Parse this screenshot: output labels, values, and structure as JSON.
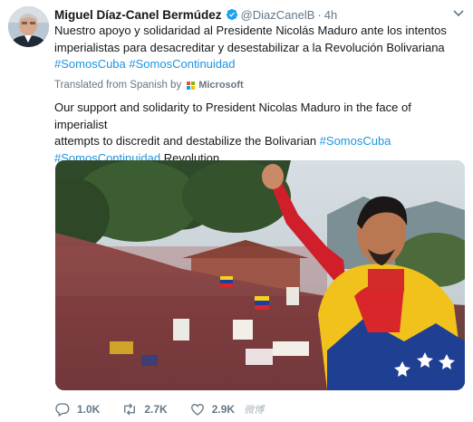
{
  "author": {
    "name": "Miguel Díaz-Canel Bermúdez",
    "handle": "@DiazCanelB",
    "separator": "·",
    "time": "4h",
    "verified": true
  },
  "tweet": {
    "original_line1": "Nuestro apoyo y solidaridad al Presidente Nicolás Maduro ante los intentos",
    "original_line2": "imperialistas para desacreditar y desestabilizar a la Revolución Bolivariana",
    "original_tag1": "#SomosCuba",
    "original_tag2": "#SomosContinuidad",
    "translated_by": "Translated from Spanish by",
    "translator": "Microsoft",
    "translated_line1": "Our support and solidarity to President Nicolas Maduro in the face of imperialist",
    "translated_line2a": "attempts to discredit and destabilize the Bolivarian",
    "translated_tag1": "#SomosCuba",
    "translated_tag2": "#SomosContinuidad",
    "translated_end": "Revolution"
  },
  "actions": {
    "reply_count": "1.0K",
    "retweet_count": "2.7K",
    "like_count": "2.9K",
    "watermark": "微博"
  },
  "colors": {
    "link": "#1b95e0",
    "text": "#14171a",
    "muted": "#657786",
    "verified": "#1da1f2"
  },
  "icons": [
    "verified-badge-icon",
    "chevron-down-icon",
    "microsoft-logo-icon",
    "reply-icon",
    "retweet-icon",
    "like-icon"
  ]
}
